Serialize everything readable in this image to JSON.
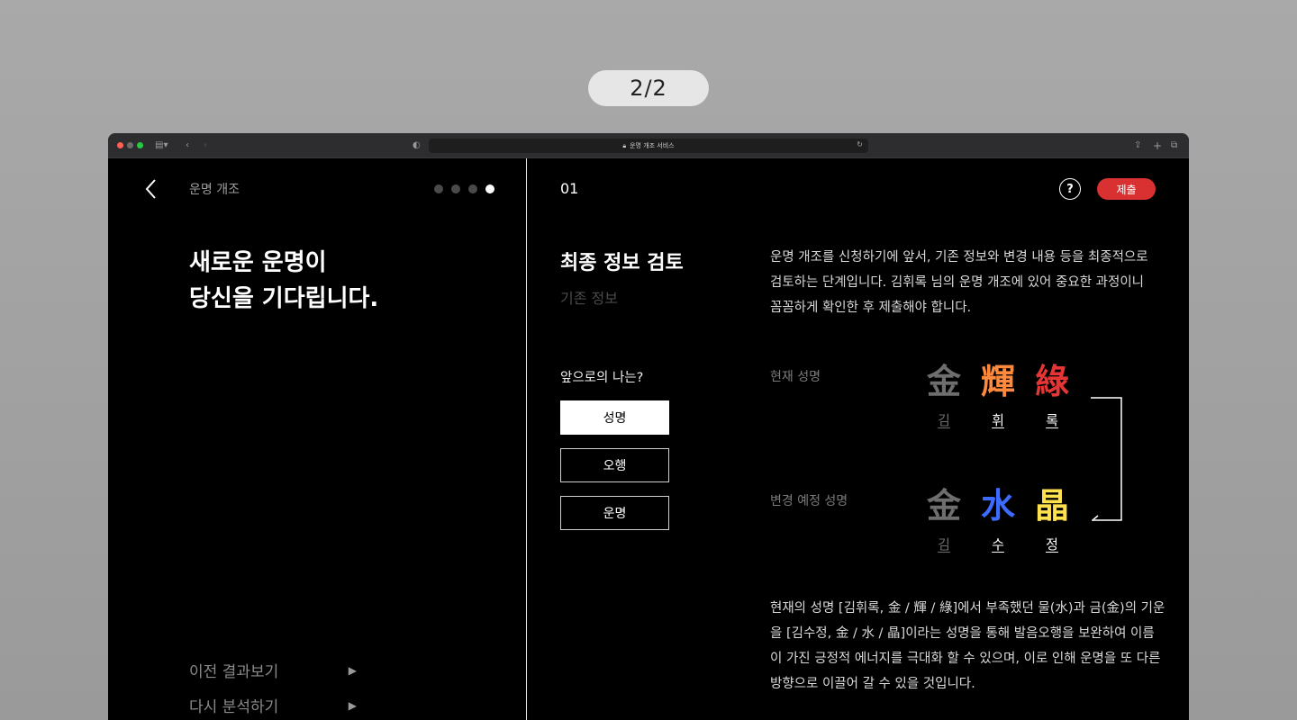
{
  "page_counter": "2/2",
  "browser": {
    "url_text": "운명 개조 서비스"
  },
  "left": {
    "title": "운명 개조",
    "progress": {
      "total": 4,
      "active_index": 3
    },
    "headline_line1": "새로운 운명이",
    "headline_line2": "당신을 기다립니다.",
    "links": [
      {
        "label": "이전 결과보기",
        "arrow": "▶"
      },
      {
        "label": "다시 분석하기",
        "arrow": "▶"
      }
    ]
  },
  "right": {
    "step_number": "01",
    "help_label": "?",
    "submit_label": "제출",
    "section_title": "최종 정보 검토",
    "section_subtitle": "기존 정보",
    "description": "운명 개조를 신청하기에 앞서, 기존 정보와 변경 내용 등을 최종적으로 검토하는 단계입니다. 김휘록 님의 운명 개조에 있어 중요한 과정이니 꼼꼼하게 확인한 후 제출해야 합니다.",
    "future_label": "앞으로의 나는?",
    "options": [
      {
        "label": "성명",
        "selected": true
      },
      {
        "label": "오행",
        "selected": false
      },
      {
        "label": "운명",
        "selected": false
      }
    ],
    "current_name": {
      "label": "현재 성명",
      "chars": [
        {
          "hanja": "金",
          "hangul": "김",
          "color": "#6e6e6e"
        },
        {
          "hanja": "輝",
          "hangul": "휘",
          "color": "#ff8a3d"
        },
        {
          "hanja": "綠",
          "hangul": "록",
          "color": "#e63535"
        }
      ]
    },
    "new_name": {
      "label": "변경 예정 성명",
      "chars": [
        {
          "hanja": "金",
          "hangul": "김",
          "color": "#6e6e6e"
        },
        {
          "hanja": "水",
          "hangul": "수",
          "color": "#3d6bff"
        },
        {
          "hanja": "晶",
          "hangul": "정",
          "color": "#ffe14d"
        }
      ]
    },
    "summary": "현재의 성명 [김휘록, 金 / 輝 / 綠]에서 부족했던 물(水)과 금(金)의 기운을 [김수정, 金 / 水 / 晶]이라는 성명을 통해 발음오행을 보완하여 이름이 가진 긍정적 에너지를 극대화 할 수 있으며, 이로 인해 운명을 또 다른 방향으로 이끌어 갈 수 있을 것입니다."
  }
}
